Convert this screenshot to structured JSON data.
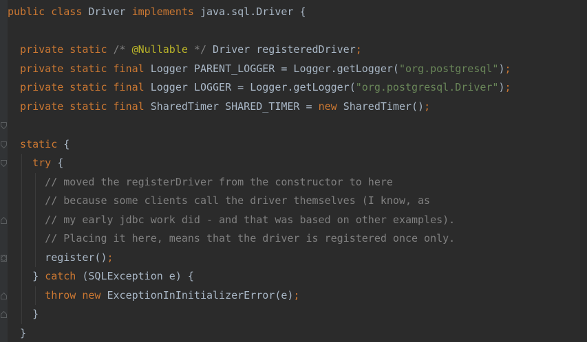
{
  "editor": {
    "language": "java",
    "theme_colors": {
      "background": "#2b2b2b",
      "gutter": "#313335",
      "default": "#a9b7c6",
      "keyword": "#cc7832",
      "comment": "#808080",
      "annotation": "#bbb529",
      "string": "#6a8759"
    },
    "lines": [
      {
        "tokens": [
          {
            "t": "public class ",
            "c": "kw"
          },
          {
            "t": "Driver ",
            "c": "tx"
          },
          {
            "t": "implements ",
            "c": "kw"
          },
          {
            "t": "java.sql.Driver {",
            "c": "tx"
          }
        ]
      },
      {
        "tokens": []
      },
      {
        "tokens": [
          {
            "t": "  private static ",
            "c": "kw"
          },
          {
            "t": "/* ",
            "c": "cm"
          },
          {
            "t": "@Nullable",
            "c": "an"
          },
          {
            "t": " */ ",
            "c": "cm"
          },
          {
            "t": "Driver registeredDriver",
            "c": "tx"
          },
          {
            "t": ";",
            "c": "kw"
          }
        ]
      },
      {
        "tokens": [
          {
            "t": "  private static final ",
            "c": "kw"
          },
          {
            "t": "Logger PARENT_LOGGER = Logger.getLogger(",
            "c": "tx"
          },
          {
            "t": "\"org.postgresql\"",
            "c": "st"
          },
          {
            "t": ")",
            "c": "tx"
          },
          {
            "t": ";",
            "c": "kw"
          }
        ]
      },
      {
        "tokens": [
          {
            "t": "  private static final ",
            "c": "kw"
          },
          {
            "t": "Logger LOGGER = Logger.getLogger(",
            "c": "tx"
          },
          {
            "t": "\"org.postgresql.Driver\"",
            "c": "st"
          },
          {
            "t": ")",
            "c": "tx"
          },
          {
            "t": ";",
            "c": "kw"
          }
        ]
      },
      {
        "tokens": [
          {
            "t": "  private static final ",
            "c": "kw"
          },
          {
            "t": "SharedTimer SHARED_TIMER = ",
            "c": "tx"
          },
          {
            "t": "new ",
            "c": "kw"
          },
          {
            "t": "SharedTimer()",
            "c": "tx"
          },
          {
            "t": ";",
            "c": "kw"
          }
        ]
      },
      {
        "tokens": []
      },
      {
        "tokens": [
          {
            "t": "  static ",
            "c": "kw"
          },
          {
            "t": "{",
            "c": "tx"
          }
        ]
      },
      {
        "tokens": [
          {
            "t": "    try ",
            "c": "kw"
          },
          {
            "t": "{",
            "c": "tx"
          }
        ]
      },
      {
        "tokens": [
          {
            "t": "      // moved the registerDriver from the constructor to here",
            "c": "cm"
          }
        ]
      },
      {
        "tokens": [
          {
            "t": "      // because some clients call the driver themselves (I know, as",
            "c": "cm"
          }
        ]
      },
      {
        "tokens": [
          {
            "t": "      // my early jdbc work did - and that was based on other examples).",
            "c": "cm"
          }
        ]
      },
      {
        "tokens": [
          {
            "t": "      // Placing it here, means that the driver is registered once only.",
            "c": "cm"
          }
        ]
      },
      {
        "tokens": [
          {
            "t": "      register()",
            "c": "tx"
          },
          {
            "t": ";",
            "c": "kw"
          }
        ]
      },
      {
        "tokens": [
          {
            "t": "    } ",
            "c": "tx"
          },
          {
            "t": "catch ",
            "c": "kw"
          },
          {
            "t": "(SQLException e) {",
            "c": "tx"
          }
        ]
      },
      {
        "tokens": [
          {
            "t": "      throw new ",
            "c": "kw"
          },
          {
            "t": "ExceptionInInitializerError(e)",
            "c": "tx"
          },
          {
            "t": ";",
            "c": "kw"
          }
        ]
      },
      {
        "tokens": [
          {
            "t": "    }",
            "c": "tx"
          }
        ]
      },
      {
        "tokens": [
          {
            "t": "  }",
            "c": "tx"
          }
        ]
      }
    ],
    "fold_markers": [
      {
        "line": 7,
        "kind": "fold-start-icon"
      },
      {
        "line": 8,
        "kind": "fold-start-icon"
      },
      {
        "line": 9,
        "kind": "fold-start-icon"
      },
      {
        "line": 12,
        "kind": "fold-end-icon"
      },
      {
        "line": 14,
        "kind": "fold-end-icon"
      },
      {
        "line": 14,
        "kind": "fold-start-icon"
      },
      {
        "line": 16,
        "kind": "fold-end-icon"
      },
      {
        "line": 17,
        "kind": "fold-end-icon"
      }
    ]
  }
}
